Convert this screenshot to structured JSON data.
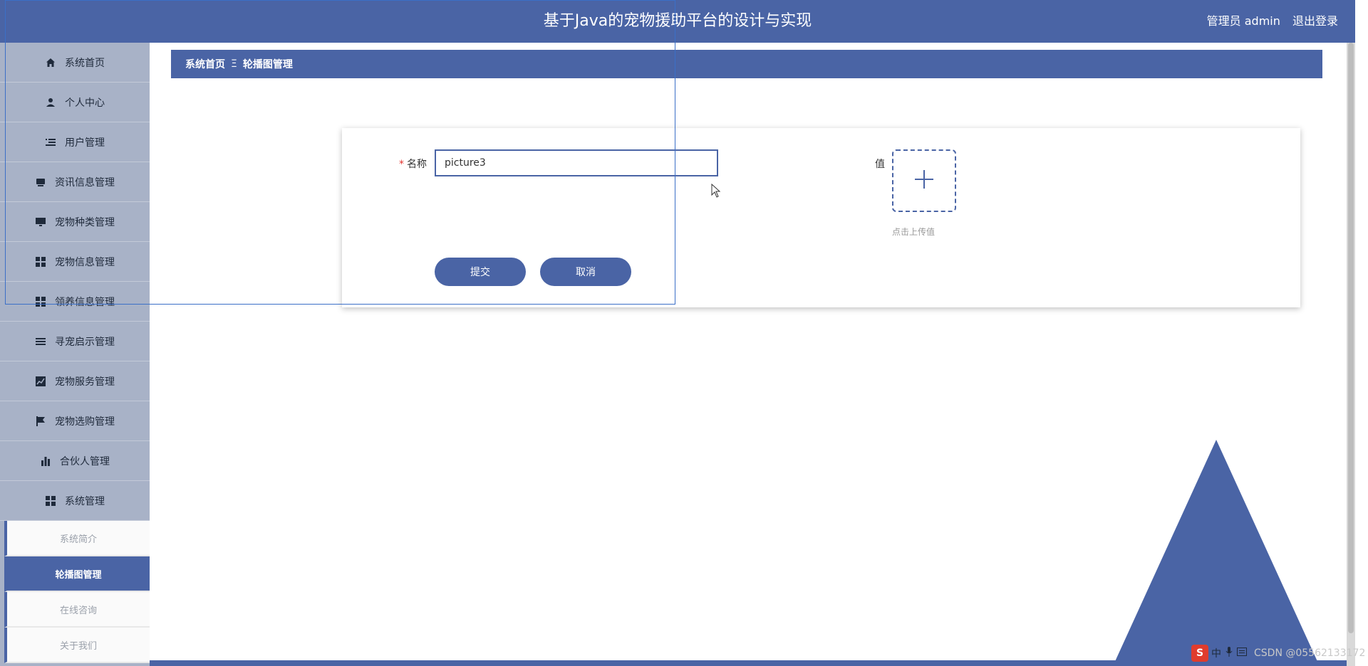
{
  "header": {
    "title": "基于Java的宠物援助平台的设计与实现",
    "user_label": "管理员 admin",
    "logout_label": "退出登录"
  },
  "sidebar": {
    "items": [
      {
        "label": "系统首页",
        "icon": "home-icon"
      },
      {
        "label": "个人中心",
        "icon": "user-icon"
      },
      {
        "label": "用户管理",
        "icon": "list-icon"
      },
      {
        "label": "资讯信息管理",
        "icon": "inbox-icon"
      },
      {
        "label": "宠物种类管理",
        "icon": "monitor-icon"
      },
      {
        "label": "宠物信息管理",
        "icon": "grid-icon"
      },
      {
        "label": "领养信息管理",
        "icon": "grid-icon"
      },
      {
        "label": "寻宠启示管理",
        "icon": "lines-icon"
      },
      {
        "label": "宠物服务管理",
        "icon": "chart-line-icon"
      },
      {
        "label": "宠物选购管理",
        "icon": "flag-icon"
      },
      {
        "label": "合伙人管理",
        "icon": "bar-chart-icon"
      },
      {
        "label": "系统管理",
        "icon": "grid-icon"
      }
    ],
    "sub_items": [
      {
        "label": "系统简介",
        "active": false
      },
      {
        "label": "轮播图管理",
        "active": true
      },
      {
        "label": "在线咨询",
        "active": false
      },
      {
        "label": "关于我们",
        "active": false
      }
    ]
  },
  "breadcrumb": {
    "home": "系统首页",
    "separator": "Ξ",
    "current": "轮播图管理"
  },
  "form": {
    "name_required_mark": "*",
    "name_label": "名称",
    "name_value": "picture3",
    "value_label": "值",
    "upload_hint": "点击上传值",
    "submit_label": "提交",
    "cancel_label": "取消"
  },
  "tray": {
    "ime_logo": "S",
    "ime_mode": "中",
    "watermark": "CSDN @05562133172"
  },
  "colors": {
    "primary": "#4a64a5",
    "sidebar_bg": "#a8b2c7",
    "required": "#e3342f"
  }
}
